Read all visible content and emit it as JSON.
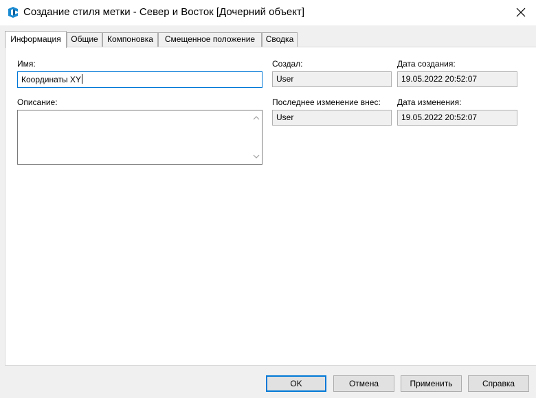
{
  "window": {
    "title": "Создание стиля метки - Север и Восток [Дочерний объект]",
    "app_icon": "civil3d-logo-icon",
    "close_icon": "close-icon"
  },
  "tabs": [
    {
      "label": "Информация",
      "active": true
    },
    {
      "label": "Общие",
      "active": false
    },
    {
      "label": "Компоновка",
      "active": false
    },
    {
      "label": "Смещенное положение",
      "active": false
    },
    {
      "label": "Сводка",
      "active": false
    }
  ],
  "info": {
    "name_label": "Имя:",
    "name_value": "Координаты XY",
    "description_label": "Описание:",
    "description_value": "",
    "created_by_label": "Создал:",
    "created_by_value": "User",
    "created_date_label": "Дата создания:",
    "created_date_value": "19.05.2022 20:52:07",
    "modified_by_label": "Последнее изменение внес:",
    "modified_by_value": "User",
    "modified_date_label": "Дата изменения:",
    "modified_date_value": "19.05.2022 20:52:07"
  },
  "buttons": {
    "ok": "OK",
    "cancel": "Отмена",
    "apply": "Применить",
    "help": "Справка"
  },
  "colors": {
    "accent": "#0078d7",
    "window_bg": "#f0f0f0",
    "panel_bg": "#ffffff"
  }
}
